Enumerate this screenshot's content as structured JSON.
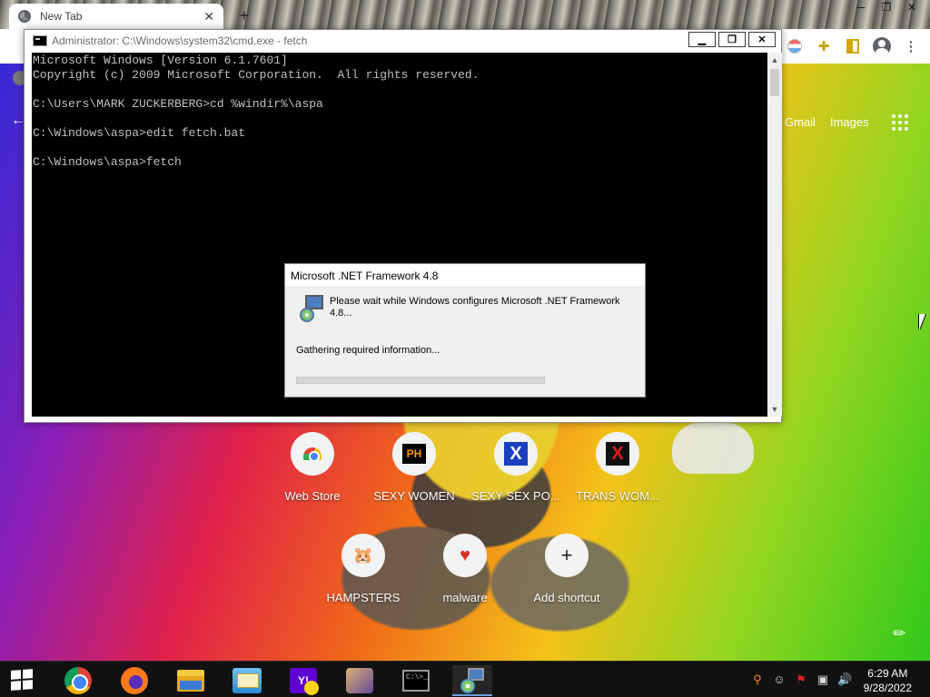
{
  "browser": {
    "tab_title": "New Tab",
    "tab_close": "✕",
    "new_tab": "+",
    "window_controls": [
      "─",
      "❐",
      "✕"
    ],
    "google_links": [
      "Gmail",
      "Images"
    ]
  },
  "cmd": {
    "title": "Administrator: C:\\Windows\\system32\\cmd.exe - fetch",
    "buttons": [
      "▁",
      "❐",
      "✕"
    ],
    "lines": [
      "Microsoft Windows [Version 6.1.7601]",
      "Copyright (c) 2009 Microsoft Corporation.  All rights reserved.",
      "",
      "C:\\Users\\MARK ZUCKERBERG>cd %windir%\\aspa",
      "",
      "C:\\Windows\\aspa>edit fetch.bat",
      "",
      "C:\\Windows\\aspa>fetch"
    ]
  },
  "net_dialog": {
    "title": "Microsoft .NET Framework 4.8",
    "message": "Please wait while Windows configures Microsoft .NET Framework 4.8...",
    "status": "Gathering required information...",
    "progress": 0
  },
  "shortcuts": [
    {
      "label": "Web Store",
      "icon": "webstore-icon"
    },
    {
      "label": "SEXY WOMEN",
      "icon": "ph-icon",
      "glyph": "PH"
    },
    {
      "label": "SEXY SEX PO...",
      "icon": "x-blue-icon",
      "glyph": "X"
    },
    {
      "label": "TRANS WOM...",
      "icon": "x-red-icon",
      "glyph": "X"
    },
    {
      "label": "HAMPSTERS",
      "icon": "hamster-icon",
      "glyph": "🐹"
    },
    {
      "label": "malware",
      "icon": "heart-icon",
      "glyph": "♥"
    },
    {
      "label": "Add shortcut",
      "icon": "plus-icon",
      "glyph": "+"
    }
  ],
  "taskbar": {
    "cmd_glyph": "C:\\>_",
    "clock_time": "6:29 AM",
    "clock_date": "9/28/2022"
  },
  "colors": {
    "console_bg": "#000000",
    "console_text": "#c0c0c0",
    "taskbar_bg": "#111111"
  }
}
